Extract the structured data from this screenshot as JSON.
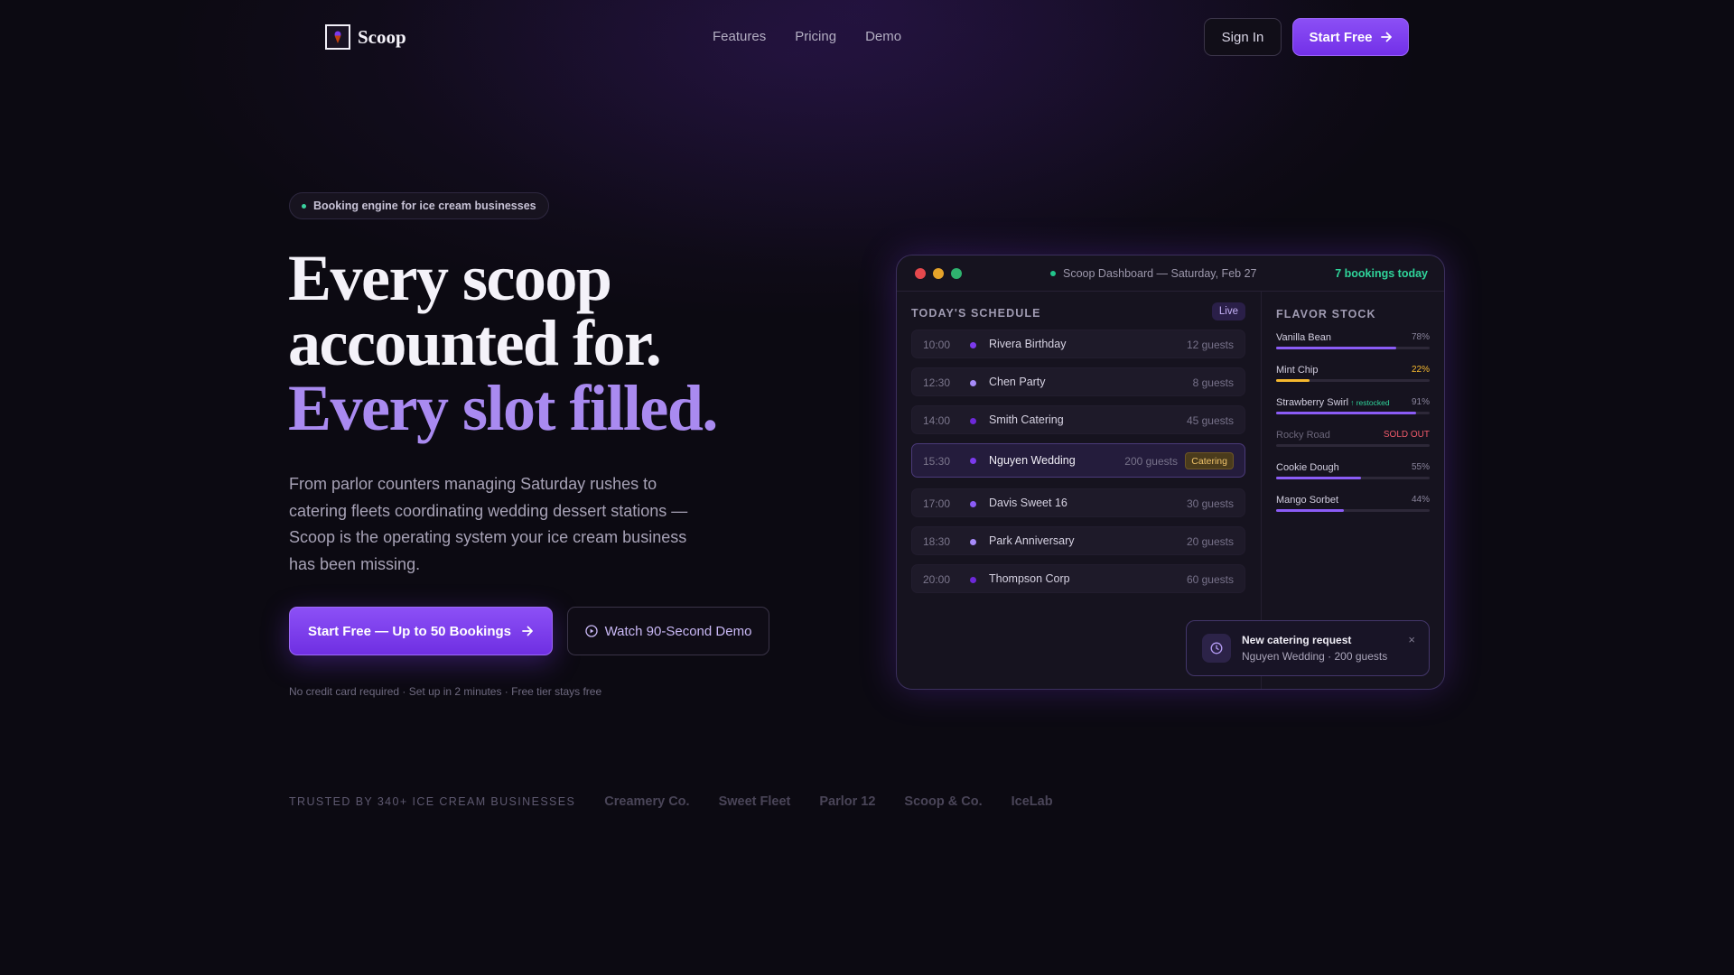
{
  "nav": {
    "brand": "Scoop",
    "links": [
      "Features",
      "Pricing",
      "Demo"
    ],
    "sign_in": "Sign In",
    "start_free": "Start Free"
  },
  "hero": {
    "badge": "Booking engine for ice cream businesses",
    "headline_line1": "Every scoop",
    "headline_line2": "accounted for.",
    "headline_line3": "Every slot filled.",
    "subtext": "From parlor counters managing Saturday rushes to catering fleets coordinating wedding dessert stations — Scoop is the operating system your ice cream business has been missing.",
    "cta_primary": "Start Free — Up to 50 Bookings",
    "cta_secondary": "Watch 90-Second Demo",
    "fineprint": "No credit card required · Set up in 2 minutes · Free tier stays free"
  },
  "trusted": {
    "label": "TRUSTED BY 340+ ICE CREAM BUSINESSES",
    "names": [
      "Creamery Co.",
      "Sweet Fleet",
      "Parlor 12",
      "Scoop & Co.",
      "IceLab"
    ]
  },
  "dashboard": {
    "title": "Scoop Dashboard — Saturday, Feb 27",
    "bookings_today": "7 bookings today",
    "schedule_title": "TODAY'S SCHEDULE",
    "live_label": "Live",
    "bookings": [
      {
        "time": "10:00",
        "name": "Rivera Birthday",
        "guests": "12 guests",
        "dot_color": "#7c3aed"
      },
      {
        "time": "12:30",
        "name": "Chen Party",
        "guests": "8 guests",
        "dot_color": "#a78bfa"
      },
      {
        "time": "14:00",
        "name": "Smith Catering",
        "guests": "45 guests",
        "dot_color": "#6d28d9"
      },
      {
        "time": "15:30",
        "name": "Nguyen Wedding",
        "guests": "200 guests",
        "dot_color": "#7c3aed",
        "tag": "Catering"
      },
      {
        "time": "17:00",
        "name": "Davis Sweet 16",
        "guests": "30 guests",
        "dot_color": "#8b5cf6"
      },
      {
        "time": "18:30",
        "name": "Park Anniversary",
        "guests": "20 guests",
        "dot_color": "#a78bfa"
      },
      {
        "time": "20:00",
        "name": "Thompson Corp",
        "guests": "60 guests",
        "dot_color": "#6d28d9"
      }
    ],
    "stock_title": "FLAVOR STOCK",
    "flavors": [
      {
        "name": "Vanilla Bean",
        "pct_label": "78%",
        "level": 78,
        "color": "#8b5cf6"
      },
      {
        "name": "Mint Chip",
        "pct_label": "22%",
        "level": 22,
        "color": "#f5b82e"
      },
      {
        "name": "Strawberry Swirl",
        "note": "↑ restocked",
        "pct_label": "91%",
        "level": 91,
        "color": "#8b5cf6"
      },
      {
        "name": "Rocky Road",
        "pct_label": "SOLD OUT",
        "level": 0,
        "color": "#ef5a6a"
      },
      {
        "name": "Cookie Dough",
        "pct_label": "55%",
        "level": 55,
        "color": "#8b5cf6"
      },
      {
        "name": "Mango Sorbet",
        "pct_label": "44%",
        "level": 44,
        "color": "#8b5cf6"
      }
    ],
    "toast": {
      "title": "New catering request",
      "subtitle": "Nguyen Wedding · 200 guests",
      "close": "×"
    }
  },
  "colors": {
    "accent": "#7c3aed",
    "accent_text": "#a98af0",
    "success": "#2fd49a",
    "warning": "#f5b82e",
    "danger": "#ef5a6a"
  }
}
